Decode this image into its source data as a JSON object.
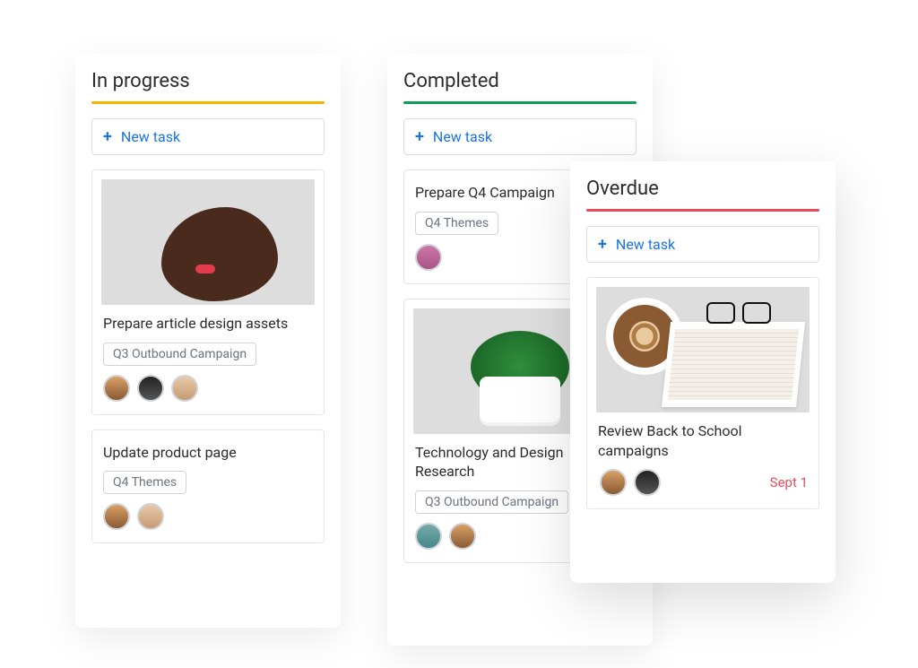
{
  "newTaskLabel": "New task",
  "columns": {
    "inProgress": {
      "title": "In progress",
      "accentColor": "#f4b400",
      "cards": [
        {
          "title": "Prepare article design assets",
          "tag": "Q3 Outbound Campaign",
          "imageDesc": "brown-dog-photo",
          "avatars": [
            "person-a",
            "person-b",
            "person-c"
          ]
        },
        {
          "title": "Update product page",
          "tag": "Q4 Themes",
          "avatars": [
            "person-a",
            "person-c"
          ]
        }
      ]
    },
    "completed": {
      "title": "Completed",
      "accentColor": "#0f9d58",
      "cards": [
        {
          "title": "Prepare Q4 Campaign",
          "tag": "Q4 Themes",
          "avatars": [
            "person-d"
          ]
        },
        {
          "title": "Technology and Design Research",
          "tag": "Q3 Outbound Campaign",
          "imageDesc": "potted-plant-photo",
          "avatars": [
            "person-e",
            "person-a"
          ]
        }
      ]
    },
    "overdue": {
      "title": "Overdue",
      "accentColor": "#ea4a5a",
      "cards": [
        {
          "title": "Review Back to School campaigns",
          "imageDesc": "coffee-book-glasses-photo",
          "avatars": [
            "person-a",
            "person-b"
          ],
          "dueLabel": "Sept 1",
          "dueColor": "#ea4a5a"
        }
      ]
    }
  }
}
